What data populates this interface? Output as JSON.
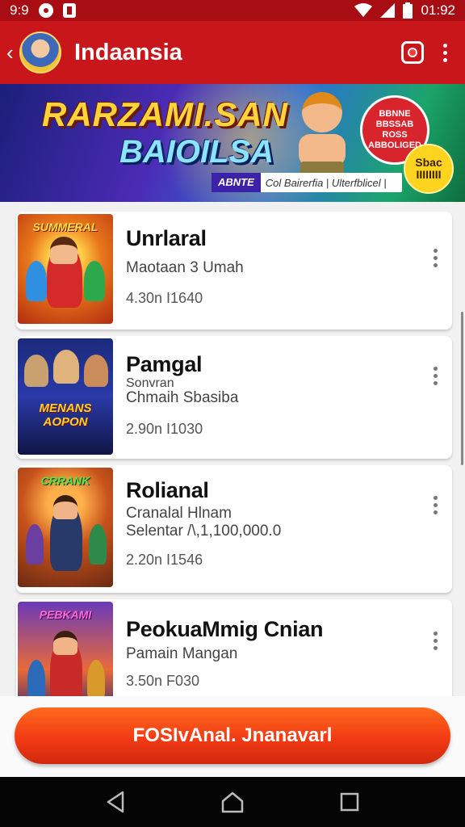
{
  "status_bar": {
    "left_text": "9:9",
    "time": "01:92"
  },
  "app_bar": {
    "title": "Indaansia"
  },
  "banner": {
    "headline_1": "RARZAMI.SAN",
    "headline_2": "BAIOILSA",
    "strip_tag": "ABNTE",
    "strip_text": "Col Bairerfia | Ulterfblicel |",
    "red_badge": "BBNNE BBSSAB ROSS ABBOLIGED",
    "yellow_badge": "Sbac IIIIIIII"
  },
  "games": [
    {
      "title": "Unrlaral",
      "sub1": "Maotaan 3 Umah",
      "sub2": "",
      "meta": "4.30n I1640",
      "thumb_text": "SUMMERAL"
    },
    {
      "title": "Pamgal",
      "sub1": "Sonvran",
      "sub2": "Chmaih Sbasiba",
      "meta": "2.90n I1030",
      "thumb_text": "MENANS AOPON"
    },
    {
      "title": "Rolianal",
      "sub1": "Cranalal Hlnam",
      "sub2": "Selentar /\\,1,100,000.0",
      "meta": "2.20n I1546",
      "thumb_text": "CRRANK"
    },
    {
      "title": "PeokuaMmig Cnian",
      "sub1": "Pamain Mangan",
      "sub2": "",
      "meta": "3.50n F030",
      "thumb_text": "PEBKAMI"
    }
  ],
  "cta": {
    "label": "FOSIvAnal. Jnanavarl"
  },
  "colors": {
    "app_bar": "#c8161b",
    "status_bar": "#a70d12",
    "cta": "#f23b14"
  },
  "icons": [
    "back-arrow-icon",
    "avatar",
    "camera-icon",
    "overflow-menu-icon",
    "nav-back-icon",
    "nav-home-icon",
    "nav-recents-icon"
  ]
}
